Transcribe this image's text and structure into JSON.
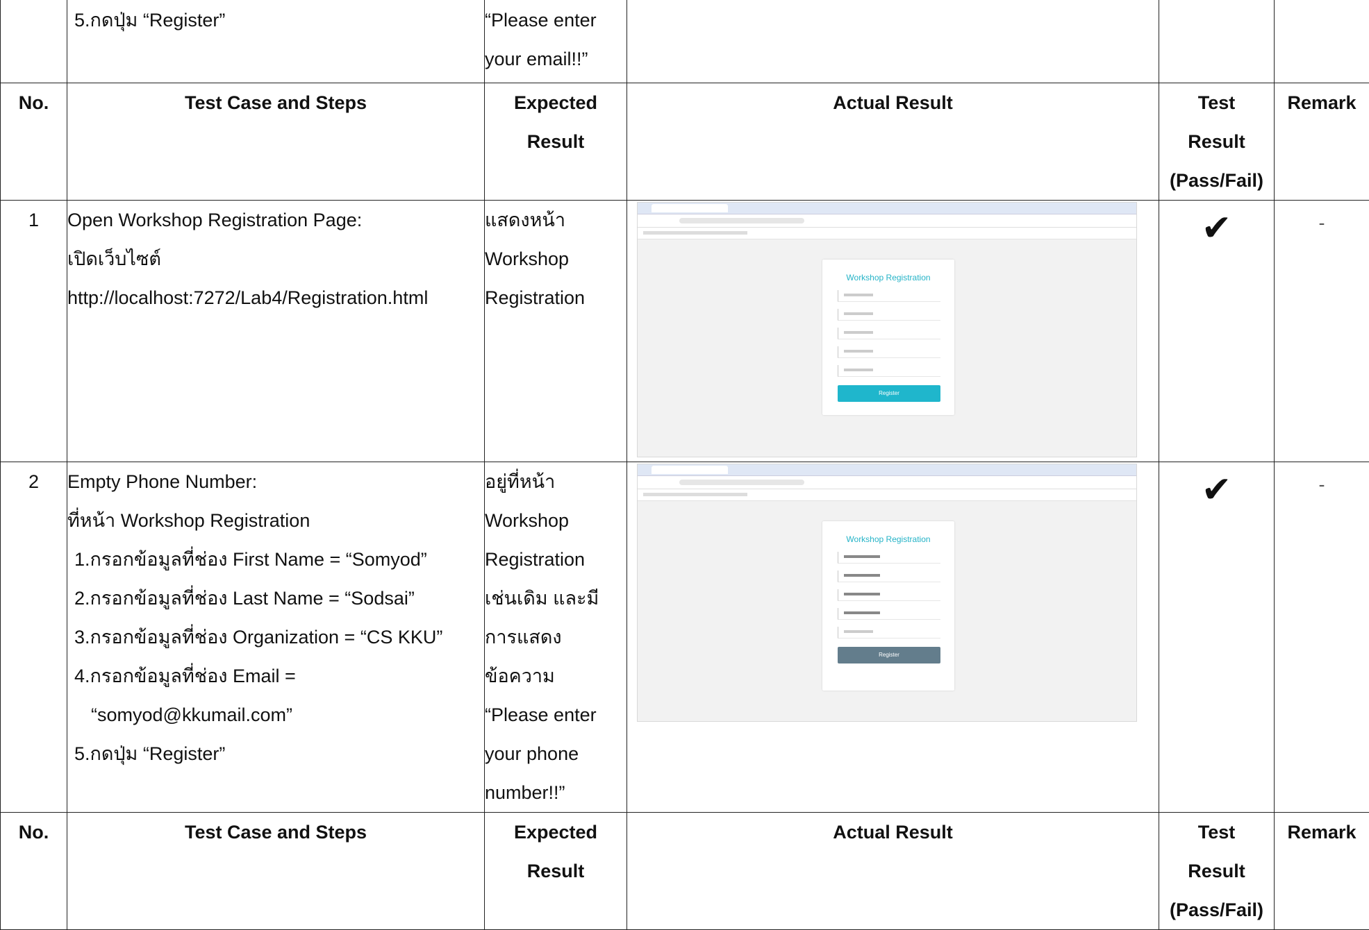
{
  "top_row": {
    "step_text": "5.กดปุ่ม “Register”",
    "expected_lines": [
      "“Please enter",
      "your email!!”"
    ]
  },
  "header": {
    "no": "No.",
    "test_case": "Test Case and Steps",
    "expected_lines": [
      "Expected",
      "Result"
    ],
    "actual": "Actual Result",
    "test_result_lines": [
      "Test",
      "Result",
      "(Pass/Fail)"
    ],
    "remark": "Remark"
  },
  "rows": [
    {
      "no": "1",
      "case_lines": [
        "Open Workshop Registration Page:",
        "เปิดเว็บไซต์",
        "http://localhost:7272/Lab4/Registration.html"
      ],
      "expected_lines": [
        "แสดงหน้า",
        "Workshop",
        "Registration"
      ],
      "screenshot": {
        "title": "Workshop Registration",
        "button_label": "Register",
        "button_color": "#1fb6cc"
      },
      "result_icon": "checkmark-icon",
      "result_symbol": "✔",
      "remark": "-"
    },
    {
      "no": "2",
      "case_title": "Empty Phone Number:",
      "case_intro": "ที่หน้า Workshop Registration",
      "steps": [
        "1.กรอกข้อมูลที่ช่อง First Name = “Somyod”",
        "2.กรอกข้อมูลที่ช่อง Last Name = “Sodsai”",
        "3.กรอกข้อมูลที่ช่อง Organization = “CS KKU”",
        "4.กรอกข้อมูลที่ช่อง Email ="
      ],
      "step_cont": "“somyod@kkumail.com”",
      "step_last": "5.กดปุ่ม “Register”",
      "expected_lines": [
        "อยู่ที่หน้า",
        "Workshop",
        "Registration",
        "เช่นเดิม และมี",
        "การแสดง",
        "ข้อความ",
        "“Please enter",
        "your phone",
        "number!!”"
      ],
      "screenshot": {
        "title": "Workshop Registration",
        "button_label": "Register",
        "button_color": "#637d8c"
      },
      "result_icon": "checkmark-icon",
      "result_symbol": "✔",
      "remark": "-"
    }
  ]
}
